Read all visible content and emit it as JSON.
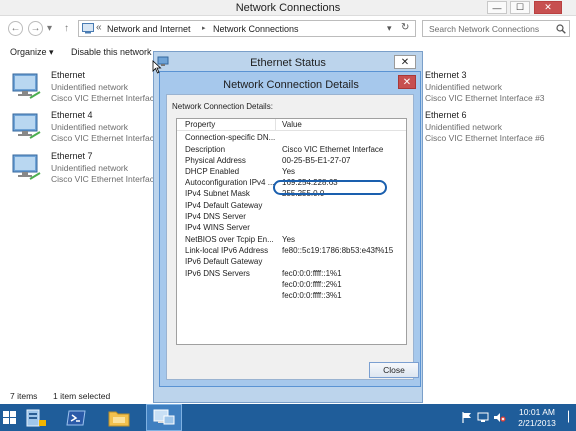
{
  "window": {
    "title": "Network Connections",
    "min_glyph": "—",
    "max_glyph": "☐",
    "close_glyph": "✕"
  },
  "nav": {
    "back_glyph": "←",
    "forward_glyph": "→",
    "dropdown_glyph": "▾",
    "up_glyph": "↑",
    "breadcrumb_prefix": "«",
    "breadcrumb": [
      "Network and Internet",
      "Network Connections"
    ],
    "separator_glyph": "▸",
    "refresh_glyph": "↻",
    "search_placeholder": "Search Network Connections"
  },
  "commands": {
    "organize": "Organize ▾",
    "disable": "Disable this network device"
  },
  "adapters": [
    {
      "name": "Ethernet",
      "status": "Unidentified network",
      "device": "Cisco VIC Ethernet Interface"
    },
    {
      "name": "Ethernet 3",
      "status": "Unidentified network",
      "device": "Cisco VIC Ethernet Interface #3"
    },
    {
      "name": "Ethernet 4",
      "status": "Unidentified network",
      "device": "Cisco VIC Ethernet Interface"
    },
    {
      "name": "Ethernet 6",
      "status": "Unidentified network",
      "device": "Cisco VIC Ethernet Interface #6"
    },
    {
      "name": "Ethernet 7",
      "status": "Unidentified network",
      "device": "Cisco VIC Ethernet Interface"
    }
  ],
  "statusbar": {
    "items": "7 items",
    "selected": "1 item selected"
  },
  "eth_status_dialog": {
    "title": "Ethernet Status",
    "close_glyph": "✕"
  },
  "details_dialog": {
    "title": "Network Connection Details",
    "close_glyph": "✕",
    "label": "Network Connection Details:",
    "col_property": "Property",
    "col_value": "Value",
    "rows": [
      {
        "p": "Connection-specific DN...",
        "v": ""
      },
      {
        "p": "Description",
        "v": "Cisco VIC Ethernet Interface"
      },
      {
        "p": "Physical Address",
        "v": "00-25-B5-E1-27-07"
      },
      {
        "p": "DHCP Enabled",
        "v": "Yes"
      },
      {
        "p": "Autoconfiguration IPv4 ...",
        "v": "169.254.228.63"
      },
      {
        "p": "IPv4 Subnet Mask",
        "v": "255.255.0.0"
      },
      {
        "p": "IPv4 Default Gateway",
        "v": ""
      },
      {
        "p": "IPv4 DNS Server",
        "v": ""
      },
      {
        "p": "IPv4 WINS Server",
        "v": ""
      },
      {
        "p": "NetBIOS over Tcpip En...",
        "v": "Yes"
      },
      {
        "p": "Link-local IPv6 Address",
        "v": "fe80::5c19:1786:8b53:e43f%15"
      },
      {
        "p": "IPv6 Default Gateway",
        "v": ""
      },
      {
        "p": "IPv6 DNS Servers",
        "v": "fec0:0:0:ffff::1%1"
      },
      {
        "p": "",
        "v": "fec0:0:0:ffff::2%1"
      },
      {
        "p": "",
        "v": "fec0:0:0:ffff::3%1"
      }
    ],
    "close_button": "Close"
  },
  "taskbar": {
    "time": "10:01 AM",
    "date": "2/21/2013",
    "show_desktop_glyph": "▏"
  },
  "colors": {
    "taskbar": "#1f5d9a",
    "highlight": "#1a5fae",
    "close_red": "#c75050"
  }
}
